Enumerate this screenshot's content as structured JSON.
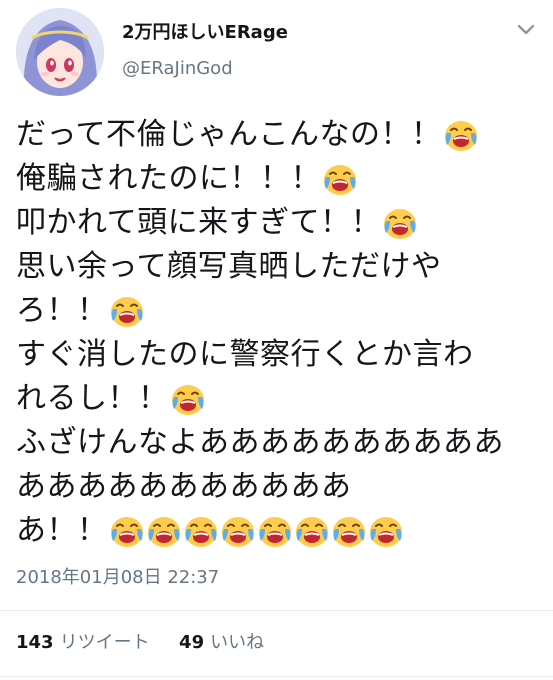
{
  "user": {
    "display_name": "2万円ほしいERage",
    "handle": "@ERaJinGod"
  },
  "tweet": {
    "lines": [
      {
        "text": "だって不倫じゃんこんなの！！",
        "emoji_count": 1
      },
      {
        "text": "俺騙されたのに！！！",
        "emoji_count": 1
      },
      {
        "text": "叩かれて頭に来すぎて！！",
        "emoji_count": 1
      },
      {
        "text": "思い余って顔写真晒しただけや",
        "emoji_count": 0
      },
      {
        "text": "ろ！！",
        "emoji_count": 1
      },
      {
        "text": "すぐ消したのに警察行くとか言わ",
        "emoji_count": 0
      },
      {
        "text": "れるし！！",
        "emoji_count": 1
      },
      {
        "text": "ふざけんなよああああああああああ",
        "emoji_count": 0
      },
      {
        "text": "あああああああああああ",
        "emoji_count": 0
      },
      {
        "text": "あ！！",
        "emoji_count": 8
      }
    ],
    "emoji_icon": "loudly-crying-face-icon",
    "timestamp": "2018年01月08日 22:37"
  },
  "stats": {
    "retweets_count": "143",
    "retweets_label": "リツイート",
    "likes_count": "49",
    "likes_label": "いいね"
  },
  "colors": {
    "text": "#14171a",
    "secondary": "#657786",
    "divider": "#e6ecf0",
    "emoji_face": "#ffcc4d",
    "emoji_tears": "#5dadec"
  }
}
